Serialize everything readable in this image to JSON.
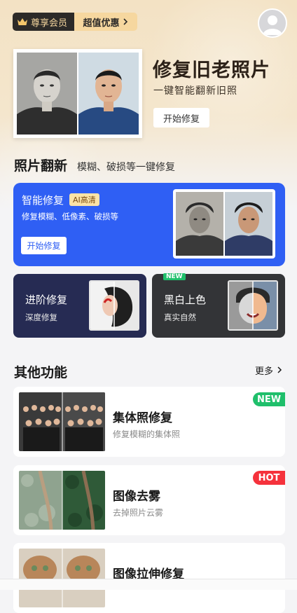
{
  "header": {
    "vip_label": "尊享会员",
    "promo_label": "超值优惠",
    "crown_icon": "crown-icon",
    "avatar_icon": "user-avatar-icon"
  },
  "hero": {
    "title": "修复旧老照片",
    "subtitle": "一键智能翻新旧照",
    "button": "开始修复"
  },
  "photo_renew": {
    "title": "照片翻新",
    "subtitle": "模糊、破损等一键修复",
    "smart_card": {
      "title": "智能修复",
      "badge": "AI高清",
      "desc": "修复模糊、低像素、破损等",
      "button": "开始修复"
    },
    "advanced_card": {
      "title": "进阶修复",
      "desc": "深度修复"
    },
    "colorize_card": {
      "title": "黑白上色",
      "desc": "真实自然",
      "badge": "NEW"
    }
  },
  "other": {
    "title": "其他功能",
    "more": "更多",
    "items": [
      {
        "title": "集体照修复",
        "desc": "修复模糊的集体照",
        "badge": "NEW",
        "badge_color": "#1fbf6b"
      },
      {
        "title": "图像去雾",
        "desc": "去掉照片云雾",
        "badge": "HOT",
        "badge_color": "#f5323c"
      },
      {
        "title": "图像拉伸修复",
        "desc": "",
        "badge": "",
        "badge_color": ""
      }
    ]
  },
  "colors": {
    "accent_blue": "#2f5ff4",
    "dark_navy": "#262b53",
    "gold": "#f6d79f"
  }
}
